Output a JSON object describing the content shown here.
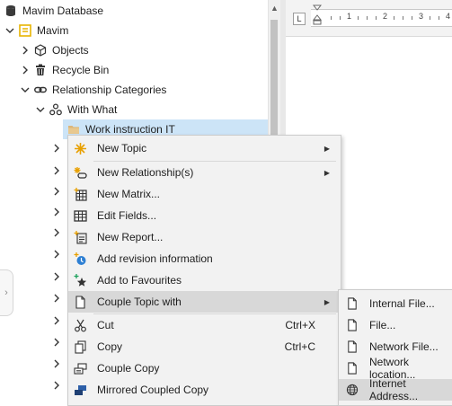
{
  "tree": {
    "items": [
      {
        "label": "Mavim Database",
        "icon": "database-icon"
      },
      {
        "label": "Mavim",
        "icon": "mavim-root-icon"
      },
      {
        "label": "Objects",
        "icon": "cube-icon"
      },
      {
        "label": "Recycle Bin",
        "icon": "trash-icon"
      },
      {
        "label": "Relationship Categories",
        "icon": "link-icon"
      },
      {
        "label": "With What",
        "icon": "share-nodes-icon"
      },
      {
        "label": "Work instruction IT",
        "icon": "folder-icon"
      }
    ],
    "side_tab_glyph": "›"
  },
  "ruler": {
    "corner": "L",
    "numbers": [
      "1",
      "2",
      "3",
      "4"
    ]
  },
  "context_menu": {
    "items": [
      {
        "label": "New Topic",
        "icon": "new-topic-icon",
        "shortcut": "",
        "has_submenu": true
      },
      {
        "label": "New Relationship(s)",
        "icon": "new-relationship-icon",
        "shortcut": "",
        "has_submenu": true
      },
      {
        "label": "New Matrix...",
        "icon": "matrix-icon",
        "shortcut": "",
        "has_submenu": false
      },
      {
        "label": "Edit Fields...",
        "icon": "grid-icon",
        "shortcut": "",
        "has_submenu": false
      },
      {
        "label": "New Report...",
        "icon": "report-icon",
        "shortcut": "",
        "has_submenu": false
      },
      {
        "label": "Add revision information",
        "icon": "revision-icon",
        "shortcut": "",
        "has_submenu": false
      },
      {
        "label": "Add to Favourites",
        "icon": "favourite-icon",
        "shortcut": "",
        "has_submenu": false
      },
      {
        "label": "Couple Topic with",
        "icon": "document-icon",
        "shortcut": "",
        "has_submenu": true
      },
      {
        "label": "Cut",
        "icon": "scissors-icon",
        "shortcut": "Ctrl+X",
        "has_submenu": false
      },
      {
        "label": "Copy",
        "icon": "copy-icon",
        "shortcut": "Ctrl+C",
        "has_submenu": false
      },
      {
        "label": "Couple Copy",
        "icon": "couple-copy-icon",
        "shortcut": "",
        "has_submenu": false
      },
      {
        "label": "Mirrored Coupled Copy",
        "icon": "mirrored-copy-icon",
        "shortcut": "",
        "has_submenu": false
      }
    ]
  },
  "submenu": {
    "items": [
      {
        "label": "Internal File...",
        "icon": "document-icon"
      },
      {
        "label": "File...",
        "icon": "document-icon"
      },
      {
        "label": "Network File...",
        "icon": "document-icon"
      },
      {
        "label": "Network location...",
        "icon": "document-icon"
      },
      {
        "label": "Internet Address...",
        "icon": "globe-icon"
      }
    ]
  },
  "colors": {
    "selection": "#cce4f7",
    "menu_bg": "#f2f2f2",
    "menu_highlight": "#d8d8d8",
    "folder": "#dcb67a",
    "mavim_yellow": "#e8b400"
  }
}
